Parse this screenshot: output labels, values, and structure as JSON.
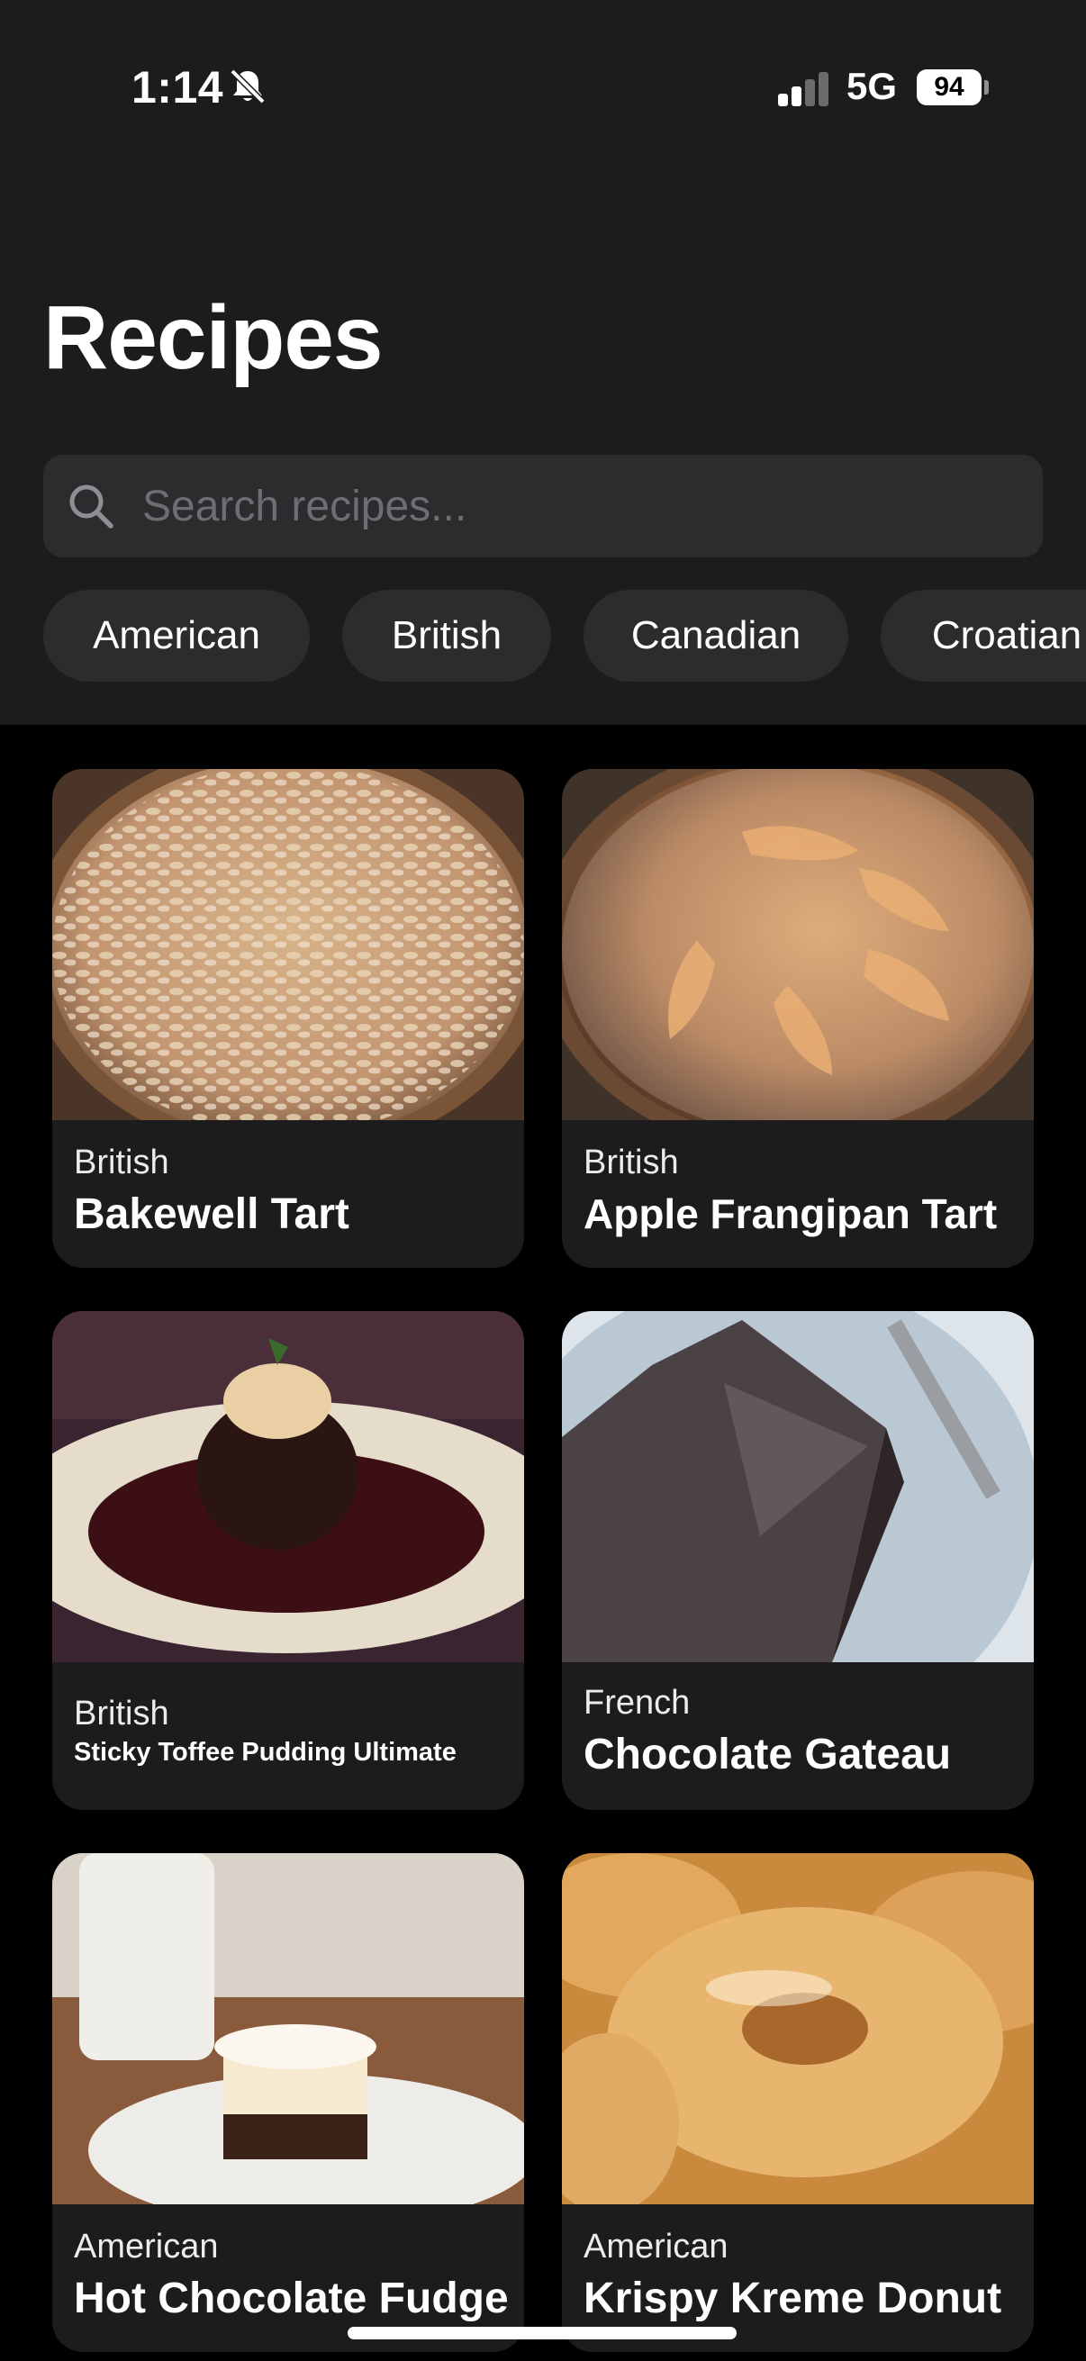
{
  "status_bar": {
    "time": "1:14",
    "network": "5G",
    "battery": "94"
  },
  "page": {
    "title": "Recipes"
  },
  "search": {
    "placeholder": "Search recipes..."
  },
  "filters": [
    "American",
    "British",
    "Canadian",
    "Croatian"
  ],
  "recipes": [
    {
      "category": "British",
      "name": "Bakewell Tart"
    },
    {
      "category": "British",
      "name": "Apple Frangipan Tart"
    },
    {
      "category": "British",
      "name": "Sticky Toffee Pudding Ultimate"
    },
    {
      "category": "French",
      "name": "Chocolate Gateau"
    },
    {
      "category": "American",
      "name": "Hot Chocolate Fudge"
    },
    {
      "category": "American",
      "name": "Krispy Kreme Donut"
    }
  ],
  "colors": {
    "background": "#000000",
    "header": "#1c1c1e",
    "card": "#1c1c1e",
    "chip": "#2c2c2e",
    "placeholder": "#6d6d72"
  },
  "icons": {
    "bell": "bell-slash-icon",
    "signal": "cellular-signal-icon",
    "search": "magnifying-glass-icon"
  }
}
